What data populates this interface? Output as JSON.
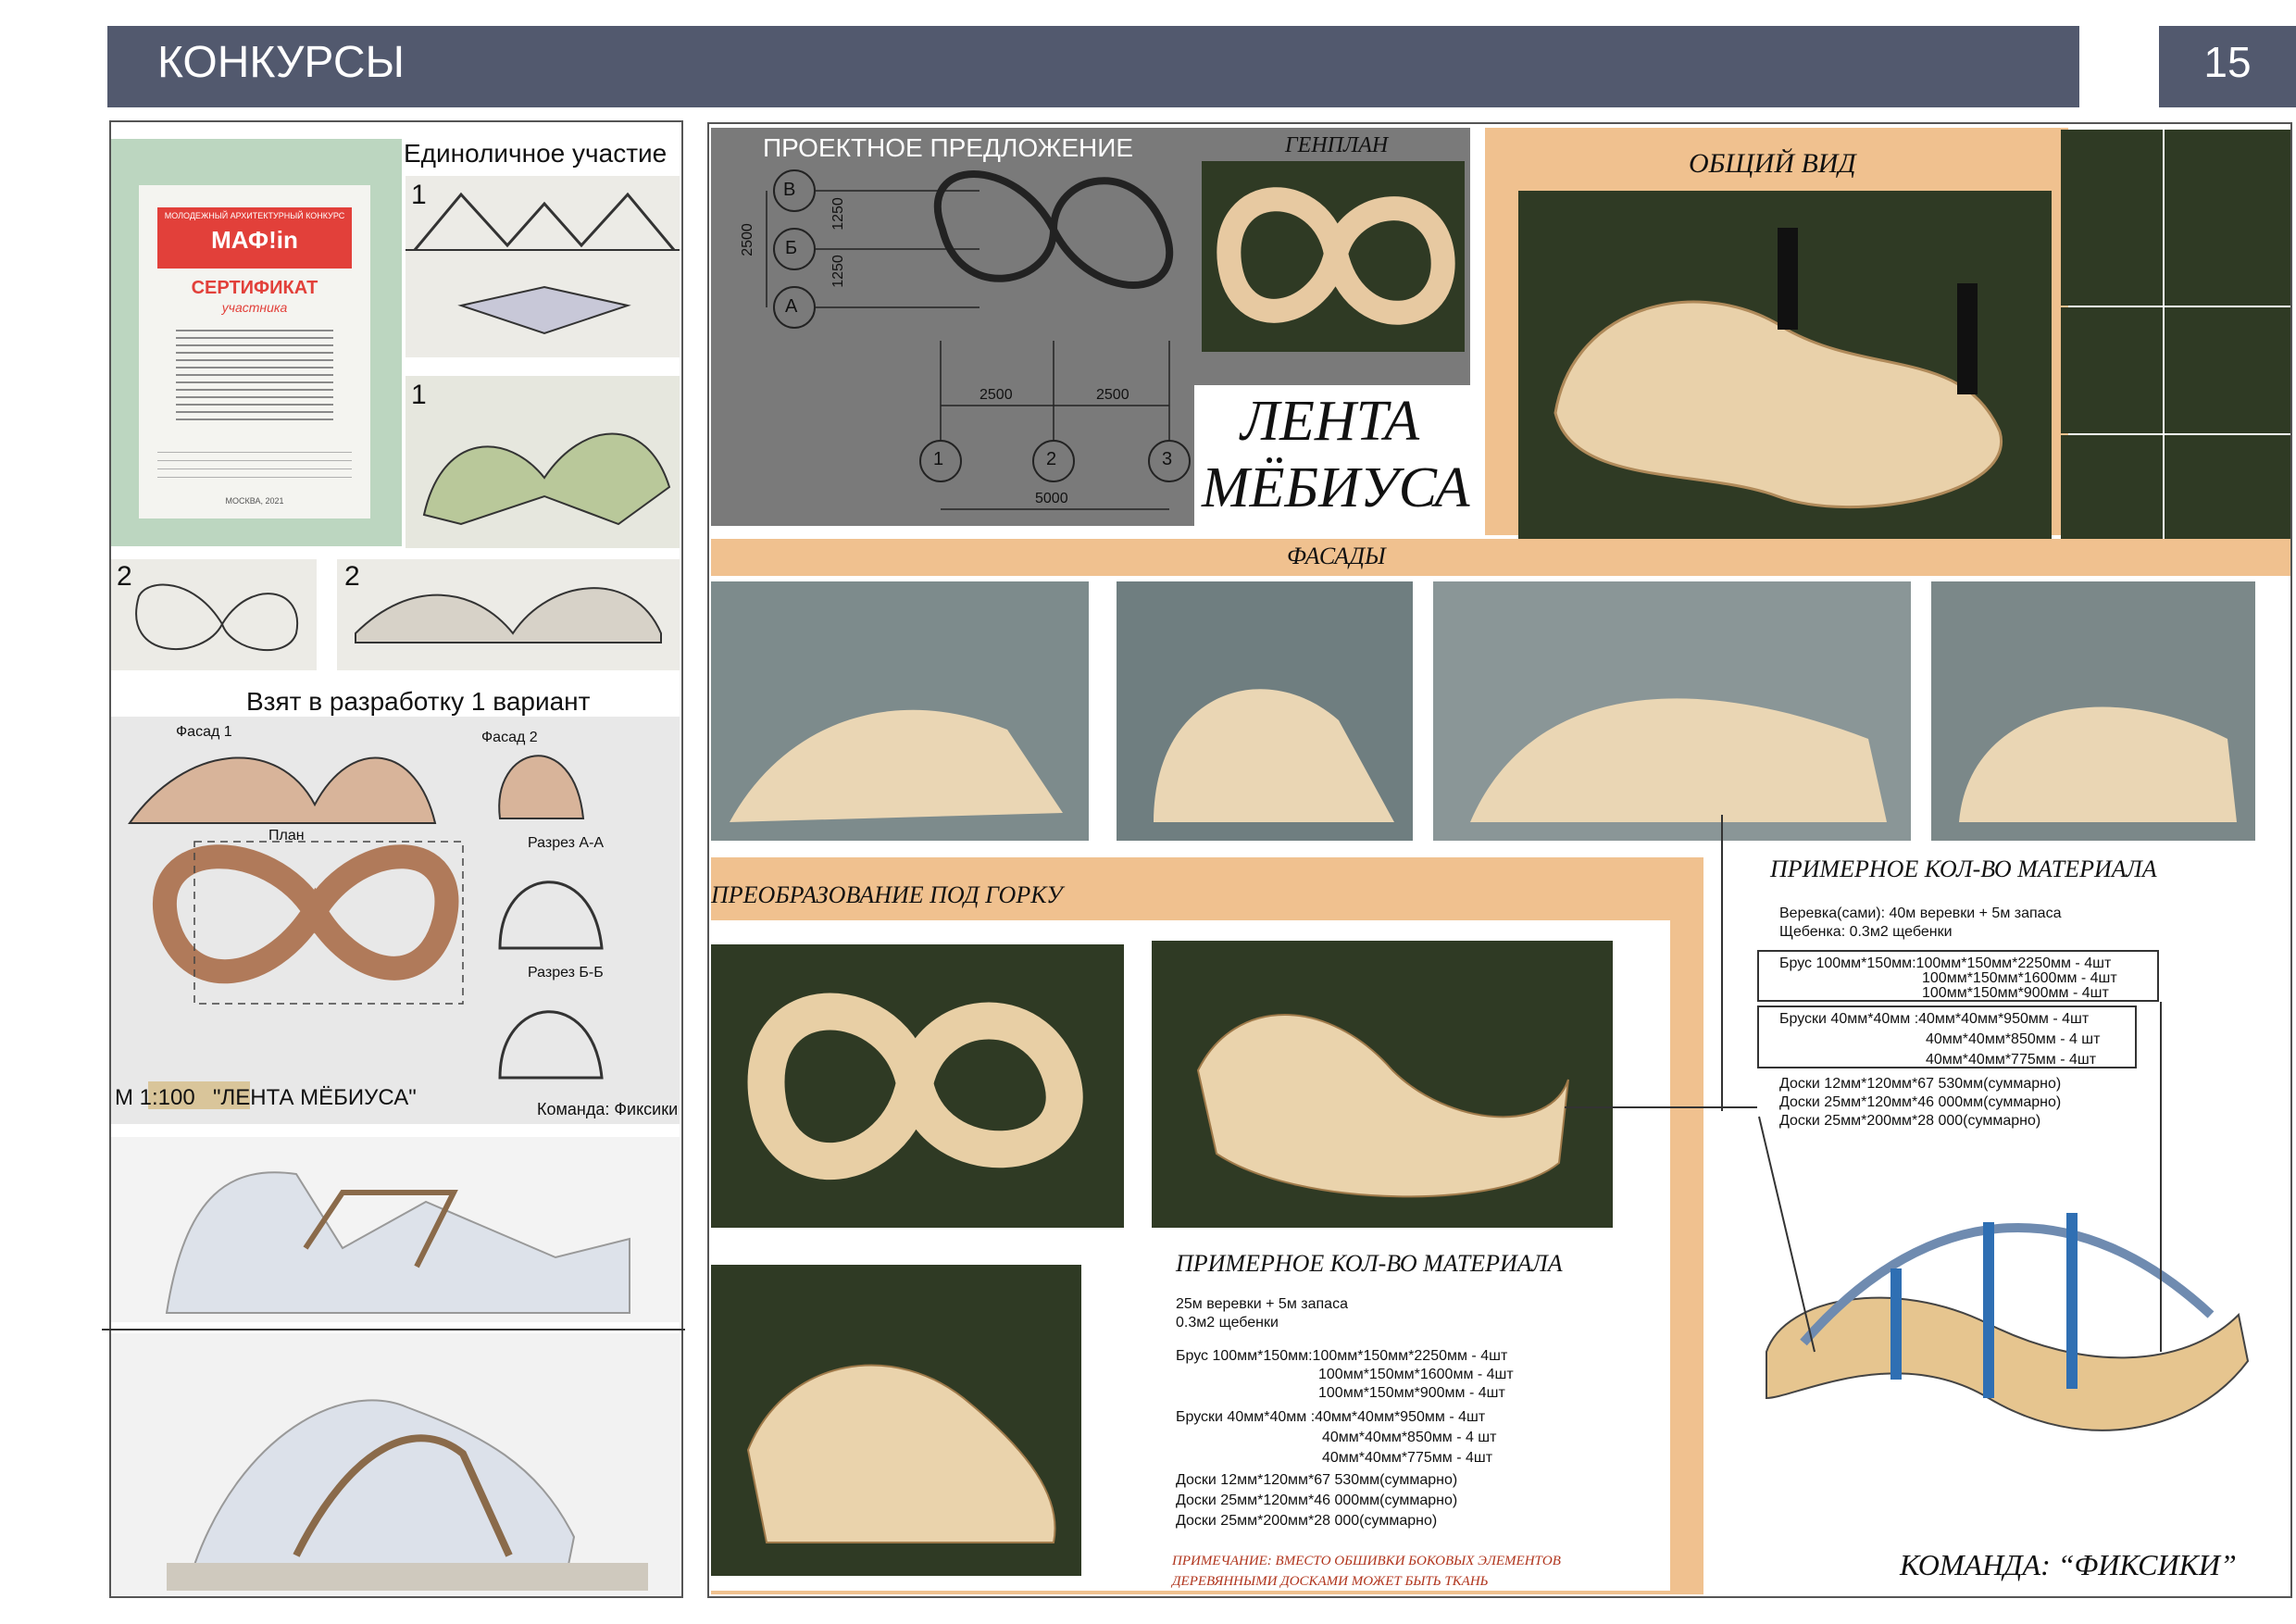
{
  "header": {
    "title": "КОНКУРСЫ",
    "page_number": "15"
  },
  "left": {
    "solo_title": "Единоличное участие",
    "sketch_numbers": [
      "1",
      "1",
      "2",
      "2"
    ],
    "taken_title": "Взят в разработку 1 вариант",
    "drawing_labels": {
      "facade1": "Фасад 1",
      "facade2": "Фасад 2",
      "plan": "План",
      "section_aa": "Разрез А-А",
      "section_bb": "Разрез Б-Б",
      "scale": "М 1:100",
      "name": "\"ЛЕНТА МЁБИУСА\"",
      "team": "Команда: Фиксики"
    },
    "certificate": {
      "competition": "МОЛОДЕЖНЫЙ АРХИТЕКТУРНЫЙ КОНКУРС",
      "brand": "МАФ!in",
      "title": "СЕРТИФИКАТ",
      "subtitle": "участника",
      "city": "МОСКВА, 2021"
    }
  },
  "right": {
    "project_proposal": "ПРОЕКТНОЕ ПРЕДЛОЖЕНИЕ",
    "genplan": "ГЕНПЛАН",
    "general_view": "ОБЩИЙ ВИД",
    "name_line1": "ЛЕНТА",
    "name_line2": "МЁБИУСА",
    "facades": "ФАСАДЫ",
    "transformation": "ПРЕОБРАЗОВАНИЕ ПОД ГОРКУ",
    "dims": {
      "axis_rows": [
        "В",
        "Б",
        "А"
      ],
      "axis_cols": [
        "1",
        "2",
        "3"
      ],
      "v_2500": "2500",
      "v_1250a": "1250",
      "v_1250b": "1250",
      "h_2500a": "2500",
      "h_2500b": "2500",
      "h_5000": "5000"
    },
    "materials_a": {
      "title": "ПРИМЕРНОЕ КОЛ-ВО МАТЕРИАЛА",
      "lines": [
        "Веревка(сами): 40м веревки + 5м запаса",
        "Щебенка: 0.3м2 щебенки",
        "Брус 100мм*150мм:100мм*150мм*2250мм - 4шт",
        "100мм*150мм*1600мм - 4шт",
        "100мм*150мм*900мм - 4шт",
        "Бруски 40мм*40мм :40мм*40мм*950мм - 4шт",
        "40мм*40мм*850мм - 4 шт",
        "40мм*40мм*775мм - 4шт",
        "Доски 12мм*120мм*67 530мм(суммарно)",
        "Доски 25мм*120мм*46 000мм(суммарно)",
        "Доски 25мм*200мм*28 000(суммарно)"
      ]
    },
    "materials_b": {
      "title": "ПРИМЕРНОЕ КОЛ-ВО МАТЕРИАЛА",
      "lines": [
        "25м веревки + 5м запаса",
        "0.3м2 щебенки",
        "Брус 100мм*150мм:100мм*150мм*2250мм - 4шт",
        "100мм*150мм*1600мм - 4шт",
        "100мм*150мм*900мм - 4шт",
        "Бруски 40мм*40мм :40мм*40мм*950мм - 4шт",
        "40мм*40мм*850мм - 4 шт",
        "40мм*40мм*775мм - 4шт",
        "Доски 12мм*120мм*67 530мм(суммарно)",
        "Доски 25мм*120мм*46 000мм(суммарно)",
        "Доски 25мм*200мм*28 000(суммарно)"
      ],
      "note_line1": "ПРИМЕЧАНИЕ: ВМЕСТО ОБШИВКИ БОКОВЫХ ЭЛЕМЕНТОВ",
      "note_line2": "ДЕРЕВЯННЫМИ ДОСКАМИ МОЖЕТ БЫТЬ ТКАНЬ"
    },
    "team": "КОМАНДА: “ФИКСИКИ”"
  },
  "colors": {
    "header": "#52596e",
    "accent_peach": "#f0c18f",
    "dark_render": "#2f3a24",
    "note_red": "#b0341c"
  }
}
